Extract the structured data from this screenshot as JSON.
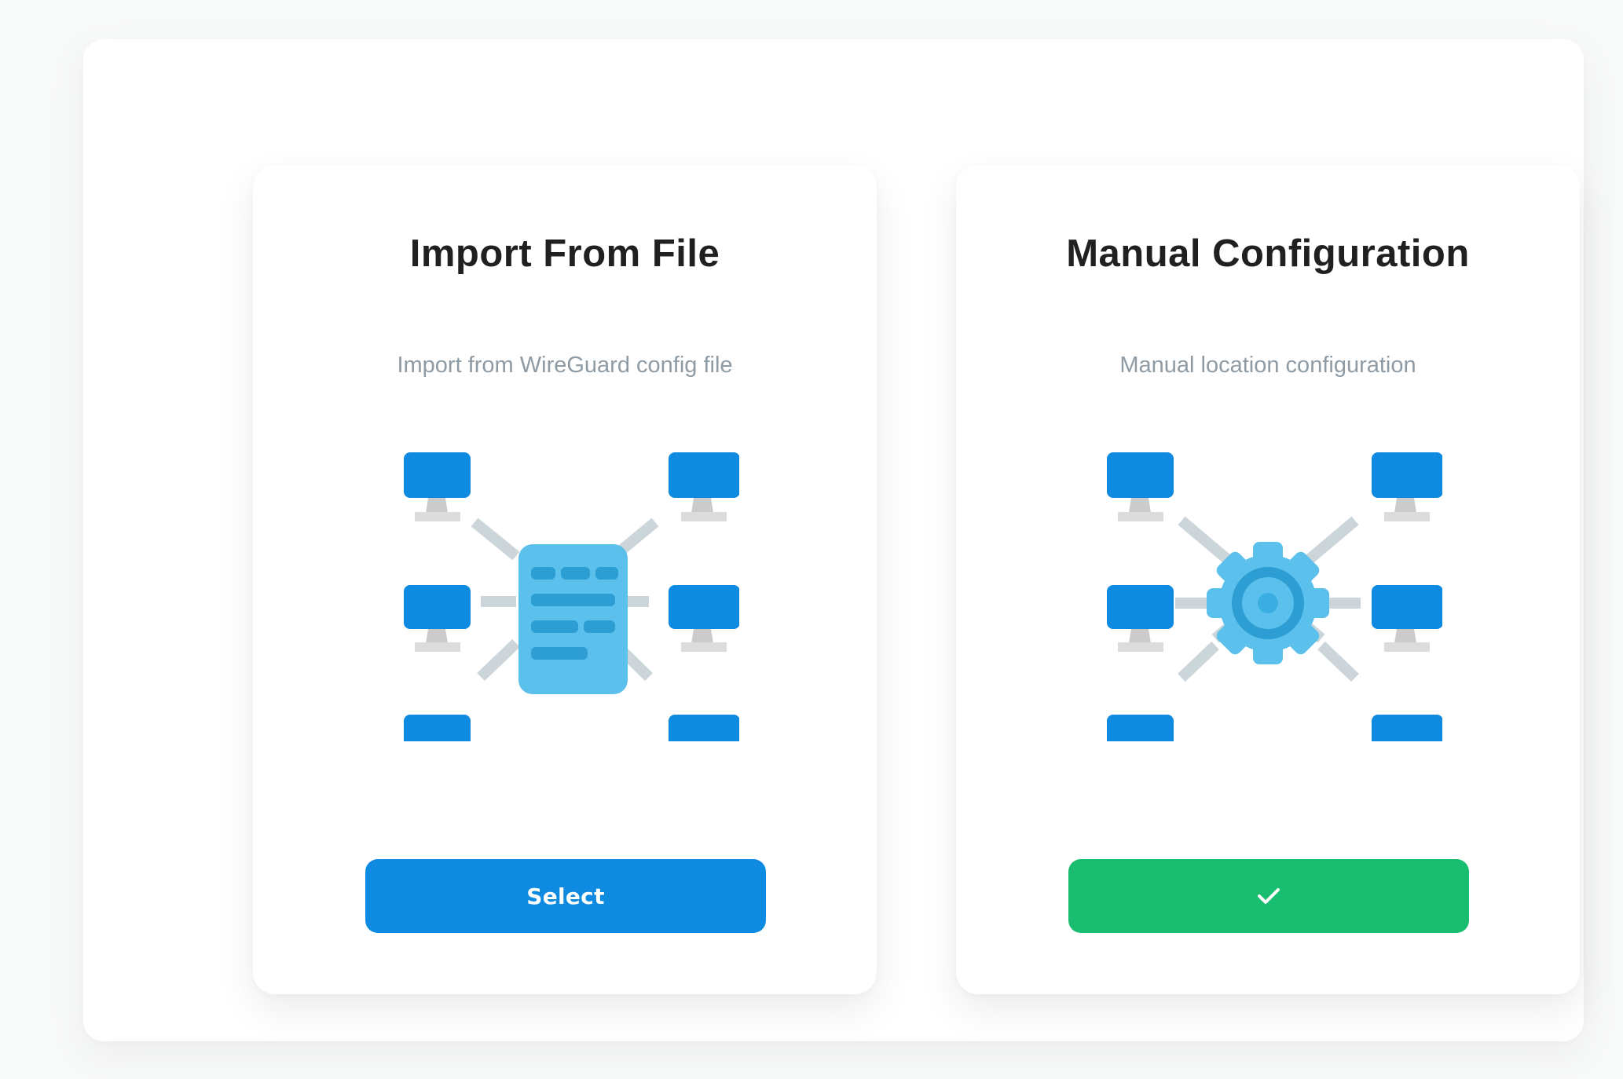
{
  "options": [
    {
      "title": "Import From File",
      "description": "Import from WireGuard config file",
      "button_label": "Select",
      "illustration_icon": "config-file-network-icon"
    },
    {
      "title": "Manual Configuration",
      "description": "Manual location configuration",
      "button_icon": "checkmark-icon",
      "illustration_icon": "gear-network-icon",
      "selected": true
    }
  ],
  "colors": {
    "primary_blue": "#0e8ae0",
    "selected_green": "#19bd6f",
    "title": "#1f2022",
    "description": "#8e9ba4",
    "monitor": "#0e8ae0",
    "light_blue": "#5bc1ec",
    "connector_gray": "#ccd5d9"
  }
}
